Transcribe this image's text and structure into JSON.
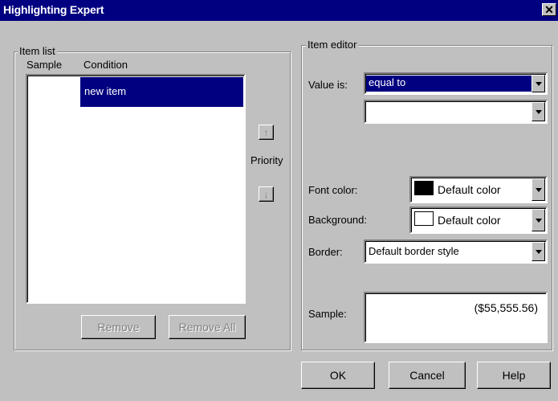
{
  "window": {
    "title": "Highlighting Expert",
    "close_glyph": "✕"
  },
  "item_list": {
    "legend": "Item list",
    "col_sample": "Sample",
    "col_condition": "Condition",
    "items": [
      {
        "condition": "new item"
      }
    ],
    "remove_label": "Remove",
    "remove_all_label": "Remove All"
  },
  "priority": {
    "label": "Priority",
    "up_glyph": "↑",
    "down_glyph": "↓"
  },
  "item_editor": {
    "legend": "Item editor",
    "value_label": "Value is:",
    "value_selected": "equal to",
    "value2": "",
    "font_color_label": "Font color:",
    "font_color_value": "Default color",
    "font_color_swatch": "#000000",
    "background_label": "Background:",
    "background_value": "Default color",
    "background_swatch": "#ffffff",
    "border_label": "Border:",
    "border_value": "Default border style",
    "sample_label": "Sample:",
    "sample_value": "($55,555.56)"
  },
  "footer": {
    "ok_label": "OK",
    "cancel_label": "Cancel",
    "help_label": "Help"
  },
  "colors": {
    "titlebar": "#000080",
    "selection": "#000080",
    "face": "#c0c0c0"
  }
}
